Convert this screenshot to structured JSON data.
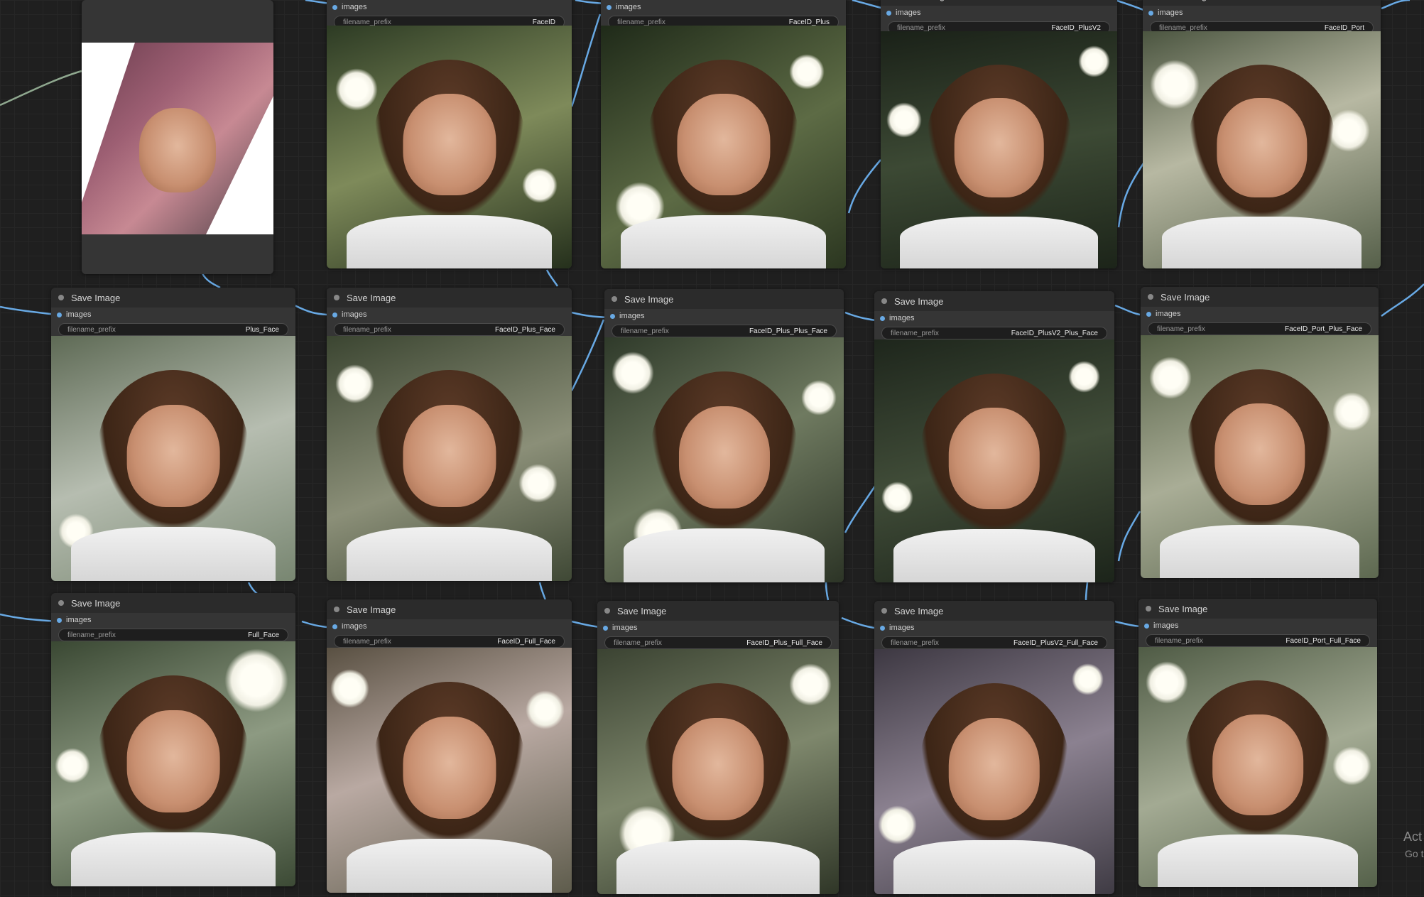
{
  "node_title": "Save Image",
  "input_label": "images",
  "widget_label": "filename_prefix",
  "colors": {
    "canvas": "#1f1f1f",
    "node_body": "#353535",
    "node_title_bar": "#2b2b2b",
    "wire": "#68a9e4",
    "wire_gray": "#8fa88f"
  },
  "source_node": {
    "icon": "image-preview"
  },
  "row0": [
    {
      "prefix": "FaceID"
    },
    {
      "prefix": "FaceID_Plus"
    },
    {
      "prefix": "FaceID_PlusV2"
    },
    {
      "prefix": "FaceID_Port"
    }
  ],
  "row1": [
    {
      "prefix": "Plus_Face"
    },
    {
      "prefix": "FaceID_Plus_Face"
    },
    {
      "prefix": "FaceID_Plus_Plus_Face"
    },
    {
      "prefix": "FaceID_PlusV2_Plus_Face"
    },
    {
      "prefix": "FaceID_Port_Plus_Face"
    }
  ],
  "row2": [
    {
      "prefix": "Full_Face"
    },
    {
      "prefix": "FaceID_Full_Face"
    },
    {
      "prefix": "FaceID_Plus_Full_Face"
    },
    {
      "prefix": "FaceID_PlusV2_Full_Face"
    },
    {
      "prefix": "FaceID_Port_Full_Face"
    }
  ],
  "watermark": {
    "line1": "Act",
    "line2": "Go t"
  }
}
